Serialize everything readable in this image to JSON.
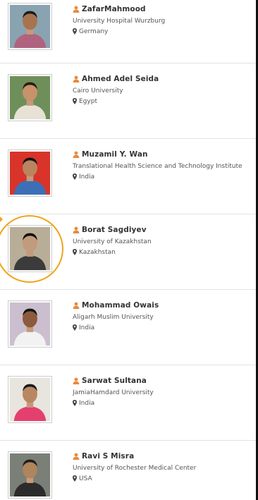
{
  "people": [
    {
      "name": "ZafarMahmood",
      "affiliation": "University Hospital Wurzburg",
      "country": "Germany",
      "avatar_icon": "person-photo-icon"
    },
    {
      "name": "Ahmed Adel Seida",
      "affiliation": "Cairo University",
      "country": "Egypt",
      "avatar_icon": "person-photo-icon"
    },
    {
      "name": "Muzamil Y. Wan",
      "affiliation": "Translational Health Science and Technology Institute",
      "country": "India",
      "avatar_icon": "person-photo-icon"
    },
    {
      "name": "Borat Sagdiyev",
      "affiliation": "University of Kazakhstan",
      "country": "Kazakhstan",
      "avatar_icon": "person-photo-icon",
      "highlighted": true
    },
    {
      "name": "Mohammad Owais",
      "affiliation": "Aligarh Muslim University",
      "country": "India",
      "avatar_icon": "person-photo-icon"
    },
    {
      "name": "Sarwat Sultana",
      "affiliation": "JamiaHamdard University",
      "country": "India",
      "avatar_icon": "person-photo-icon"
    },
    {
      "name": "Ravi S Misra",
      "affiliation": "University of Rochester Medical Center",
      "country": "USA",
      "avatar_icon": "person-photo-icon"
    }
  ],
  "colors": {
    "accent": "#e9893a",
    "highlight": "#f0a41a",
    "name_text": "#333333",
    "meta_text": "#555555"
  },
  "icons": {
    "name_icon": "user-icon",
    "location_icon": "map-pin-icon"
  }
}
